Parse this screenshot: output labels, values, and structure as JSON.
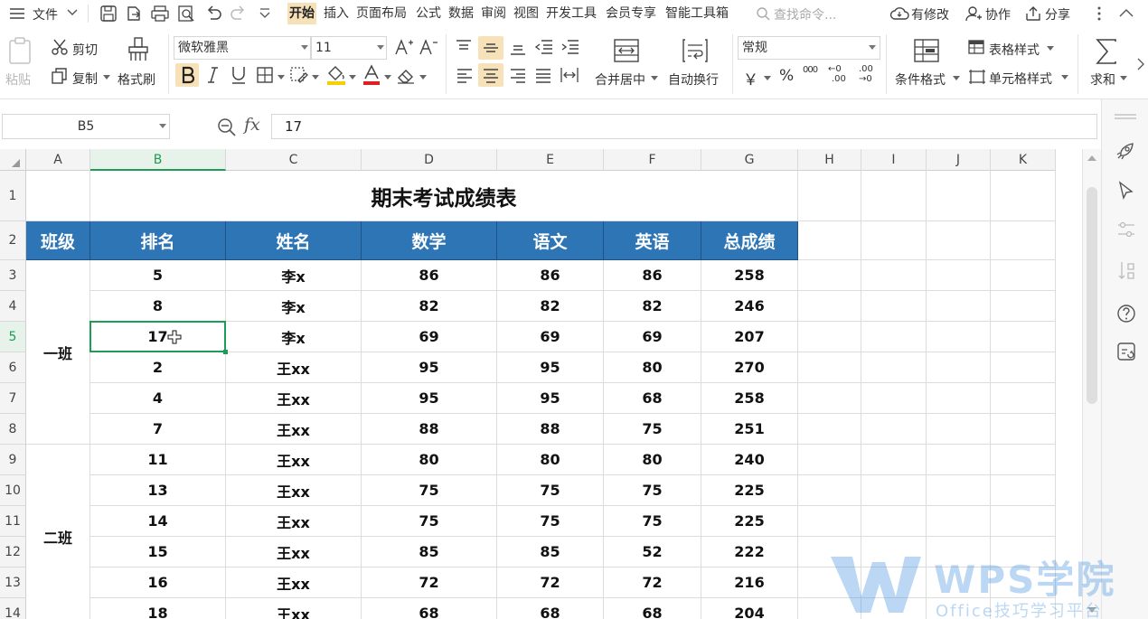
{
  "menubar": {
    "file_label": "文件",
    "tabs": [
      {
        "label": "开始",
        "active": true
      },
      {
        "label": "插入"
      },
      {
        "label": "页面布局"
      },
      {
        "label": "公式"
      },
      {
        "label": "数据"
      },
      {
        "label": "审阅"
      },
      {
        "label": "视图"
      },
      {
        "label": "开发工具"
      },
      {
        "label": "会员专享"
      },
      {
        "label": "智能工具箱"
      }
    ],
    "search_placeholder": "查找命令...",
    "changes_label": "有修改",
    "collab_label": "协作",
    "share_label": "分享"
  },
  "ribbon": {
    "paste_label": "粘贴",
    "cut_label": "剪切",
    "copy_label": "复制",
    "format_painter_label": "格式刷",
    "font_name": "微软雅黑",
    "font_size": "11",
    "merge_label": "合并居中",
    "wrap_label": "自动换行",
    "number_format": "常规",
    "cond_format_label": "条件格式",
    "table_style_label": "表格样式",
    "cell_style_label": "单元格样式",
    "sum_label": "求和",
    "currency_symbol": "￥",
    "percent_symbol": "%",
    "thousands_symbol": "000",
    "inc_decimal_top": "←0",
    "inc_decimal_bottom": ".00",
    "dec_decimal_top": ".00",
    "dec_decimal_bottom": "→0"
  },
  "formula_bar": {
    "name_box": "B5",
    "fx_label": "fx",
    "value": "17"
  },
  "sheet": {
    "columns": [
      "A",
      "B",
      "C",
      "D",
      "E",
      "F",
      "G",
      "H",
      "I",
      "J",
      "K"
    ],
    "selected_column": "B",
    "selected_row": 5,
    "rows": [
      1,
      2,
      3,
      4,
      5,
      6,
      7,
      8,
      9,
      10,
      11,
      12,
      13,
      14
    ],
    "title": "期末考试成绩表",
    "headers": [
      "班级",
      "排名",
      "姓名",
      "数学",
      "语文",
      "英语",
      "总成绩"
    ],
    "class_labels": [
      "一班",
      "二班"
    ],
    "data": [
      [
        "5",
        "李x",
        "86",
        "86",
        "86",
        "258"
      ],
      [
        "8",
        "李x",
        "82",
        "82",
        "82",
        "246"
      ],
      [
        "17",
        "李x",
        "69",
        "69",
        "69",
        "207"
      ],
      [
        "2",
        "王xx",
        "95",
        "95",
        "80",
        "270"
      ],
      [
        "4",
        "王xx",
        "95",
        "95",
        "68",
        "258"
      ],
      [
        "7",
        "王xx",
        "88",
        "88",
        "75",
        "251"
      ],
      [
        "11",
        "王xx",
        "80",
        "80",
        "80",
        "240"
      ],
      [
        "13",
        "王xx",
        "75",
        "75",
        "75",
        "225"
      ],
      [
        "14",
        "王xx",
        "75",
        "75",
        "75",
        "225"
      ],
      [
        "15",
        "王xx",
        "85",
        "85",
        "52",
        "222"
      ],
      [
        "16",
        "王xx",
        "72",
        "72",
        "72",
        "216"
      ],
      [
        "18",
        "王xx",
        "68",
        "68",
        "68",
        "204"
      ]
    ]
  },
  "watermark": {
    "brand": "WPS学院",
    "tagline": "Office技巧学习平台"
  },
  "colors": {
    "header_fill": "#2e75b6",
    "selection_green": "#1e9b55",
    "active_highlight": "#f7e1b8"
  }
}
